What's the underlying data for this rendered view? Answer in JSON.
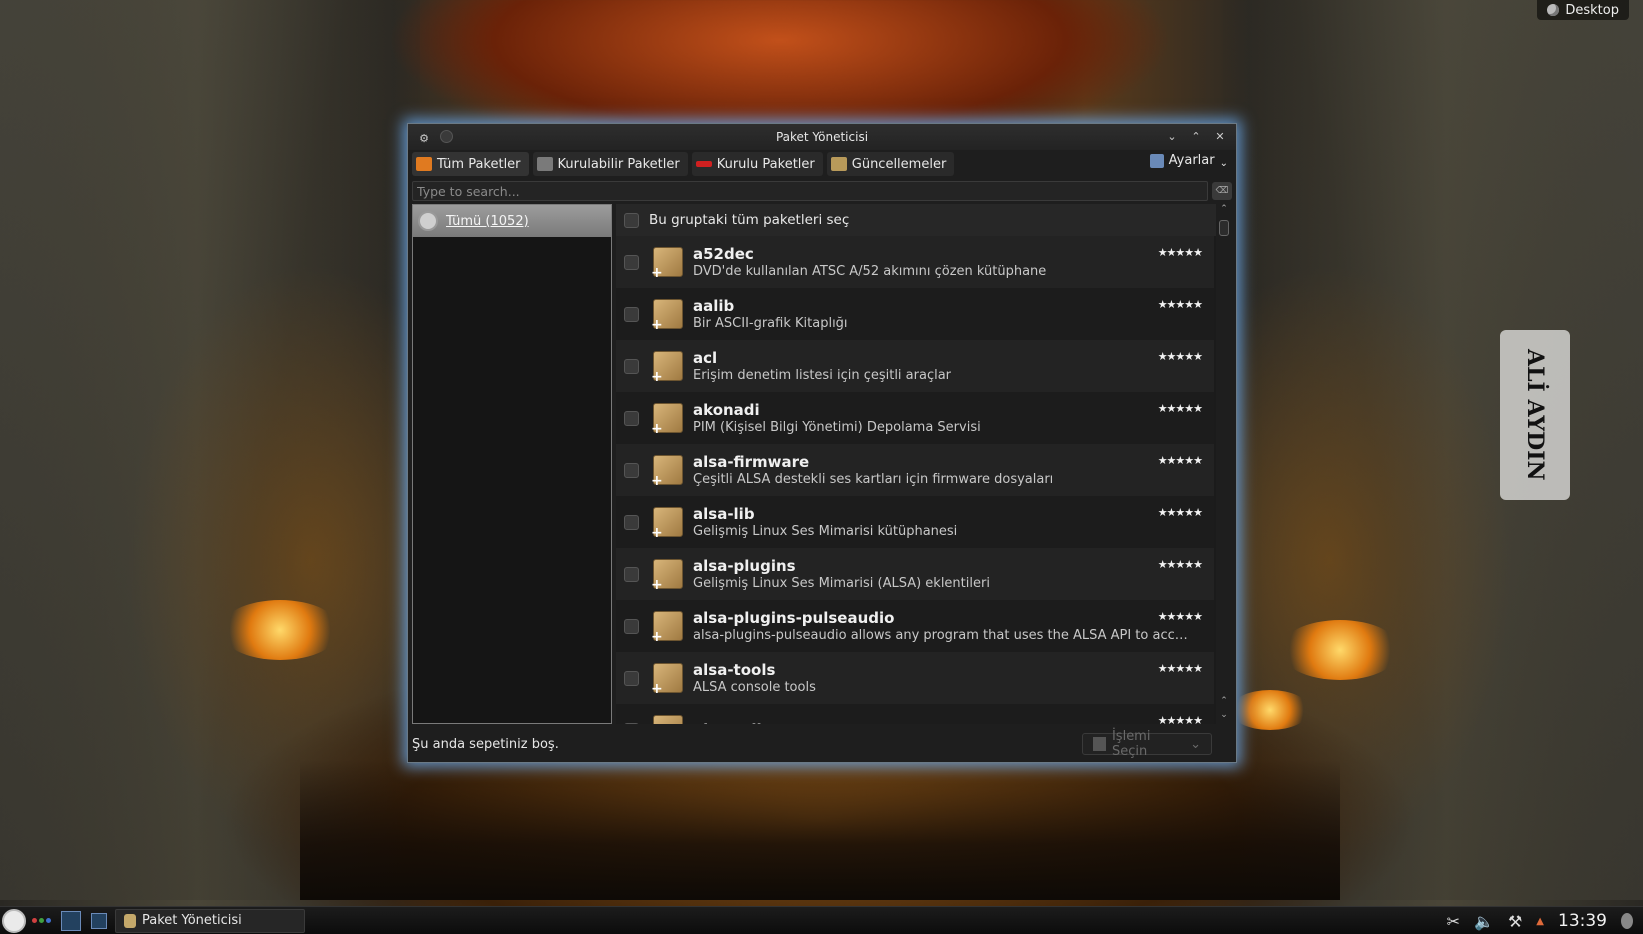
{
  "desktop": {
    "widget_label": "Desktop",
    "watermark_text": "ALİ AYDIN"
  },
  "window": {
    "title": "Paket Yöneticisi",
    "tabs": [
      {
        "label": "Tüm Paketler",
        "icon": "all-packages-icon",
        "color": "#e07a20"
      },
      {
        "label": "Kurulabilir Paketler",
        "icon": "installable-icon",
        "color": "#7a7a7a"
      },
      {
        "label": "Kurulu Paketler",
        "icon": "installed-icon",
        "color": "#d02020"
      },
      {
        "label": "Güncellemeler",
        "icon": "updates-icon",
        "color": "#b89a5a"
      }
    ],
    "settings_label": "Ayarlar",
    "search": {
      "placeholder": "Type to search...",
      "value": ""
    },
    "groups": [
      {
        "label": "Tümü (1052)"
      }
    ],
    "select_all_label": "Bu gruptaki tüm paketleri seç",
    "packages": [
      {
        "name": "a52dec",
        "desc": "DVD'de kullanılan ATSC A/52 akımını çözen kütüphane",
        "rating": "★★★★★"
      },
      {
        "name": "aalib",
        "desc": "Bir ASCII-grafik Kitaplığı",
        "rating": "★★★★★"
      },
      {
        "name": "acl",
        "desc": "Erişim denetim listesi için çeşitli araçlar",
        "rating": "★★★★★"
      },
      {
        "name": "akonadi",
        "desc": "PIM (Kişisel Bilgi Yönetimi) Depolama Servisi",
        "rating": "★★★★★"
      },
      {
        "name": "alsa-firmware",
        "desc": "Çeşitli ALSA destekli ses kartları için firmware dosyaları",
        "rating": "★★★★★"
      },
      {
        "name": "alsa-lib",
        "desc": "Gelişmiş Linux Ses Mimarisi kütüphanesi",
        "rating": "★★★★★"
      },
      {
        "name": "alsa-plugins",
        "desc": "Gelişmiş Linux Ses Mimarisi (ALSA) eklentileri",
        "rating": "★★★★★"
      },
      {
        "name": "alsa-plugins-pulseaudio",
        "desc": "alsa-plugins-pulseaudio allows any program that uses the ALSA API to acces...",
        "rating": "★★★★★"
      },
      {
        "name": "alsa-tools",
        "desc": "ALSA console tools",
        "rating": "★★★★★"
      },
      {
        "name": "alsa-utils",
        "desc": "",
        "rating": "★★★★★"
      }
    ],
    "status_message": "Şu anda sepetiniz boş.",
    "action_button_label": "İşlemi Seçin"
  },
  "taskbar": {
    "task_label": "Paket Yöneticisi",
    "clock": "13:39",
    "dot_colors": [
      "#d04040",
      "#40a040",
      "#4070d0"
    ]
  }
}
